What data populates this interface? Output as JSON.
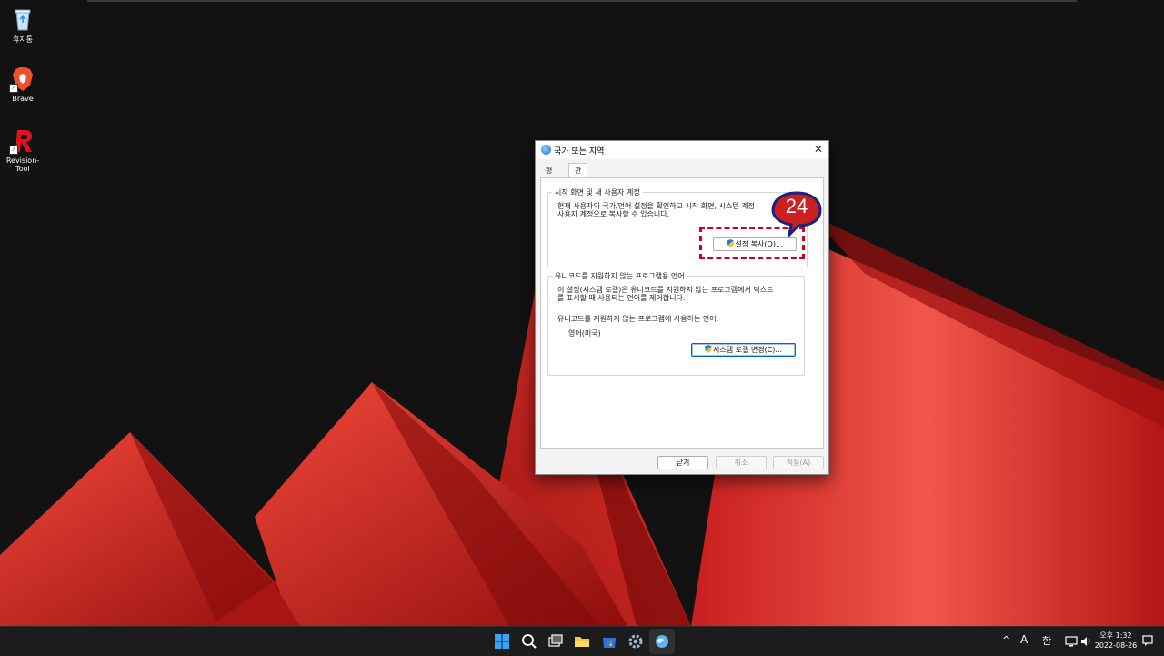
{
  "desktop": {
    "icons": [
      {
        "label": "휴지통"
      },
      {
        "label": "Brave"
      },
      {
        "label": "Revision-Tool"
      }
    ]
  },
  "dialog": {
    "title": "국가 또는 지역",
    "close_glyph": "✕",
    "tabs": [
      {
        "label": "형식",
        "active": false
      },
      {
        "label": "관리자 옵션",
        "active": true
      }
    ],
    "group_welcome": {
      "legend": "시작 화면 및 새 사용자 계정",
      "description_line1": "현재 사용자의 국가/언어 설정을 확인하고 시작 화면, 시스템 계정",
      "description_line2": "사용자 계정으로 복사할 수 있습니다.",
      "copy_button": "설정 복사(O)..."
    },
    "group_unicode": {
      "legend": "유니코드를 지원하지 않는 프로그램용 언어",
      "description_line1": "이 설정(시스템 로캘)은 유니코드를 지원하지 않는 프로그램에서 텍스트",
      "description_line2": "를 표시할 때 사용되는 언어를 제어합니다.",
      "current_label": "유니코드를 지원하지 않는 프로그램에 사용하는 언어:",
      "current_value": "영어(미국)",
      "change_button": "시스템 로캘 변경(C)..."
    },
    "footer": {
      "ok": "닫기",
      "cancel": "취소",
      "apply": "적용(A)"
    }
  },
  "annotation": {
    "step_number": "24",
    "color": "#d0021b",
    "badge_color": "#cc1f1f",
    "badge_border": "#1a237e"
  },
  "taskbar": {
    "icons": [
      "windows-start-icon",
      "search-icon",
      "task-view-icon",
      "file-explorer-icon",
      "store-icon",
      "settings-gear-icon",
      "region-globe-icon"
    ],
    "tray": {
      "chevron": "^",
      "ime_mode": "A",
      "ime_lang": "한",
      "time": "오후 1:32",
      "date": "2022-08-26"
    }
  },
  "colors": {
    "wallpaper_accent": "#e23a2c",
    "taskbar_bg": "#1c1c1c",
    "focus_blue": "#0067c0"
  }
}
